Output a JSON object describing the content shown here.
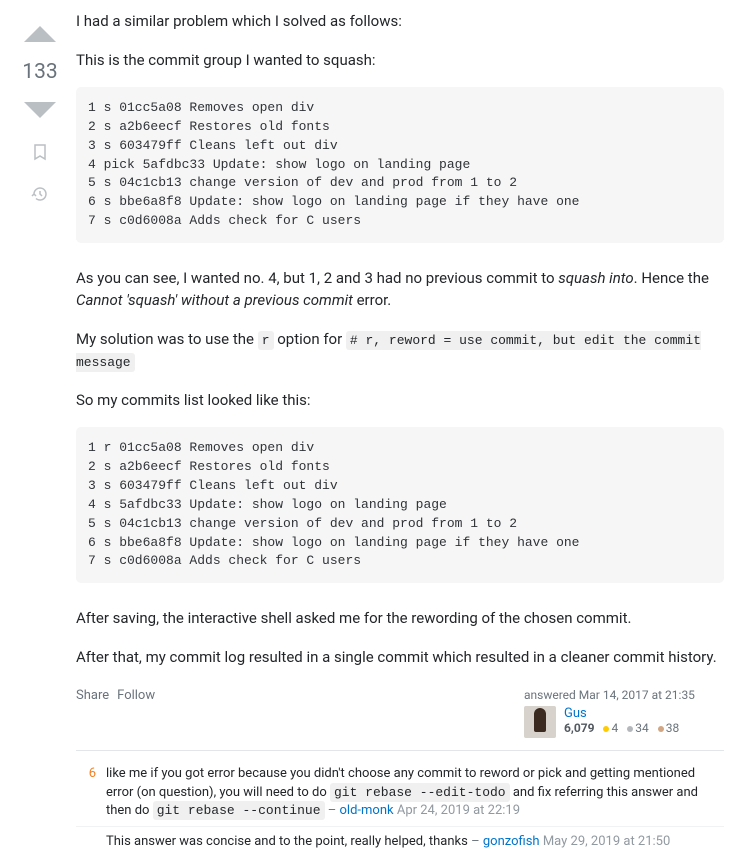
{
  "vote": {
    "score": "133"
  },
  "post": {
    "intro": "I had a similar problem which I solved as follows:",
    "group_intro": "This is the commit group I wanted to squash:",
    "code1": "1 s 01cc5a08 Removes open div\n2 s a2b6eecf Restores old fonts\n3 s 603479ff Cleans left out div\n4 pick 5afdbc33 Update: show logo on landing page\n5 s 04c1cb13 change version of dev and prod from 1 to 2\n6 s bbe6a8f8 Update: show logo on landing page if they have one\n7 s c0d6008a Adds check for C users",
    "p2_a": "As you can see, I wanted no. 4, but 1, 2 and 3 had no previous commit to ",
    "p2_em1": "squash into",
    "p2_b": ". Hence the ",
    "p2_em2": "Cannot 'squash' without a previous commit",
    "p2_c": " error.",
    "p3_a": "My solution was to use the ",
    "p3_code1": "r",
    "p3_b": " option for ",
    "p3_code2": "# r, reword = use commit, but edit the commit message",
    "p4": "So my commits list looked like this:",
    "code2": "1 r 01cc5a08 Removes open div\n2 s a2b6eecf Restores old fonts\n3 s 603479ff Cleans left out div\n4 s 5afdbc33 Update: show logo on landing page\n5 s 04c1cb13 change version of dev and prod from 1 to 2\n6 s bbe6a8f8 Update: show logo on landing page if they have one\n7 s c0d6008a Adds check for C users",
    "p5": "After saving, the interactive shell asked me for the rewording of the chosen commit.",
    "p6": "After that, my commit log resulted in a single commit which resulted in a cleaner commit history."
  },
  "actions": {
    "share": "Share",
    "follow": "Follow"
  },
  "usercard": {
    "answered": "answered Mar 14, 2017 at 21:35",
    "name": "Gus",
    "rep": "6,079",
    "gold": "4",
    "silver": "34",
    "bronze": "38"
  },
  "comments": [
    {
      "score": "6",
      "text_a": "like me if you got error because you didn't choose any commit to reword or pick and getting mentioned error (on question), you will need to do ",
      "code1": "git rebase --edit-todo",
      "text_b": " and fix referring this answer and then do ",
      "code2": "git rebase --continue",
      "author": "old-monk",
      "date": "Apr 24, 2019 at 22:19"
    },
    {
      "score": "",
      "text_a": "This answer was concise and to the point, really helped, thanks",
      "author": "gonzofish",
      "date": "May 29, 2019 at 21:50"
    }
  ]
}
